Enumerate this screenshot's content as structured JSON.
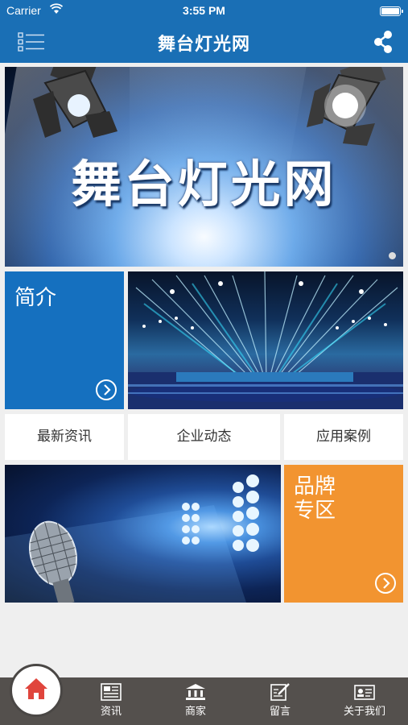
{
  "status_bar": {
    "carrier": "Carrier",
    "time": "3:55 PM"
  },
  "navbar": {
    "title": "舞台灯光网",
    "menu_icon": "list-menu-icon",
    "share_icon": "share-icon"
  },
  "banner": {
    "headline": "舞台灯光网",
    "page_indicator_count": 1
  },
  "tiles": {
    "intro": {
      "label": "简介",
      "color": "#1570bf"
    },
    "brand": {
      "label": "品牌专区",
      "color": "#f29430"
    }
  },
  "links": [
    {
      "label": "最新资讯"
    },
    {
      "label": "企业动态"
    },
    {
      "label": "应用案例"
    }
  ],
  "tabbar": {
    "home_icon": "home-icon",
    "items": [
      {
        "label": "资讯",
        "icon": "newspaper-icon"
      },
      {
        "label": "商家",
        "icon": "bank-icon"
      },
      {
        "label": "留言",
        "icon": "edit-note-icon"
      },
      {
        "label": "关于我们",
        "icon": "id-card-icon"
      }
    ]
  },
  "colors": {
    "primary": "#1a6fb5",
    "tabbar": "#54504d",
    "home_accent": "#e0453c"
  }
}
